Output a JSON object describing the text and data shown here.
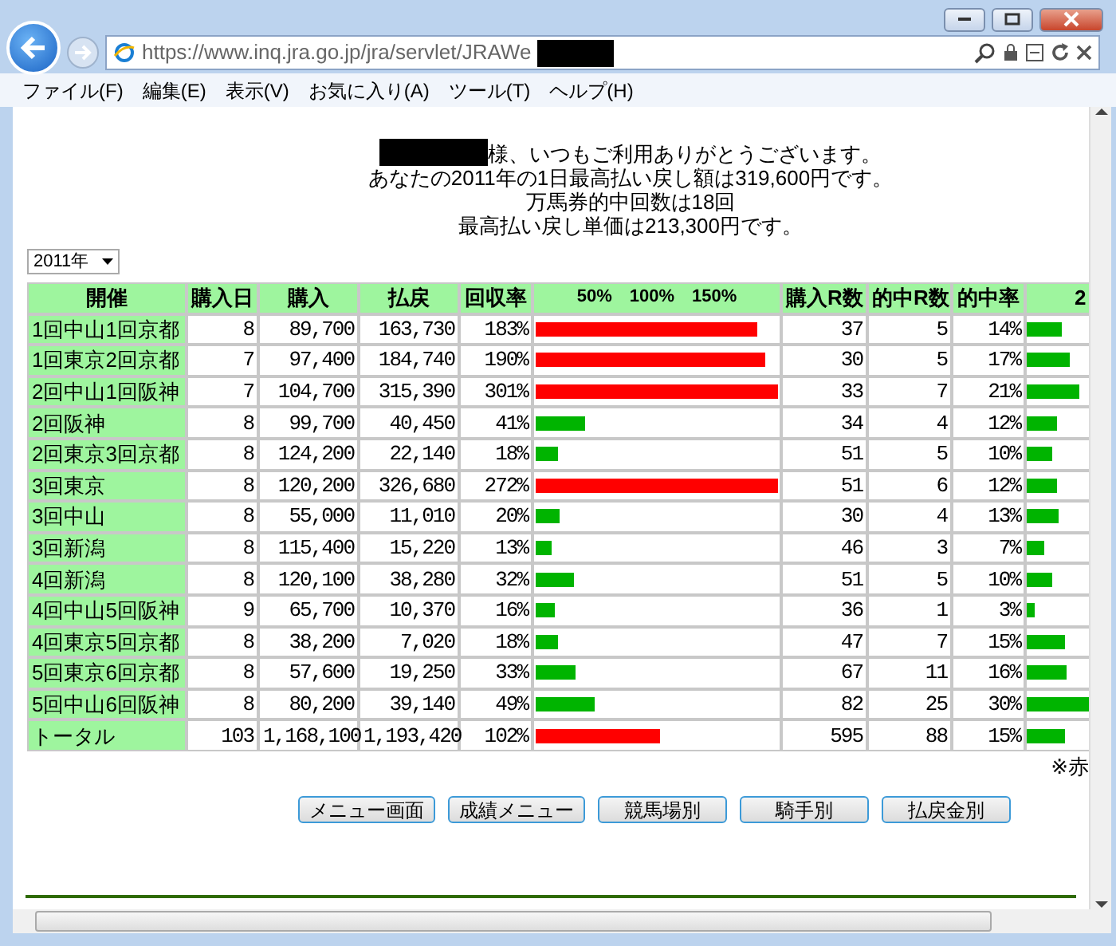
{
  "browser": {
    "url": "https://www.inq.jra.go.jp/jra/servlet/JRAWe",
    "menus": [
      "ファイル(F)",
      "編集(E)",
      "表示(V)",
      "お気に入り(A)",
      "ツール(T)",
      "ヘルプ(H)"
    ]
  },
  "greeting": [
    "様、いつもご利用ありがとうございます。",
    "あなたの2011年の1日最高払い戻し額は319,600円です。",
    "万馬券的中回数は18回",
    "最高払い戻し単価は213,300円です。"
  ],
  "year_select": "2011年",
  "table": {
    "columns": [
      "開催",
      "購入日",
      "購入",
      "払戻",
      "回収率",
      "50%　100%　150%",
      "購入R数",
      "的中R数",
      "的中率",
      "2"
    ],
    "rows": [
      {
        "venue": "1回中山1回京都",
        "days": "8",
        "bought": "89,700",
        "payout": "163,730",
        "rate": "183%",
        "rate_bar": {
          "level": 0.915,
          "color": "#ff0000"
        },
        "races": "37",
        "hits": "5",
        "hit_rate": "14%",
        "hit_bar": {
          "level": 0.14
        }
      },
      {
        "venue": "1回東京2回京都",
        "days": "7",
        "bought": "97,400",
        "payout": "184,740",
        "rate": "190%",
        "rate_bar": {
          "level": 0.95,
          "color": "#ff0000"
        },
        "races": "30",
        "hits": "5",
        "hit_rate": "17%",
        "hit_bar": {
          "level": 0.17
        }
      },
      {
        "venue": "2回中山1回阪神",
        "days": "7",
        "bought": "104,700",
        "payout": "315,390",
        "rate": "301%",
        "rate_bar": {
          "level": 1,
          "color": "#ff0000"
        },
        "races": "33",
        "hits": "7",
        "hit_rate": "21%",
        "hit_bar": {
          "level": 0.21
        }
      },
      {
        "venue": "2回阪神",
        "days": "8",
        "bought": "99,700",
        "payout": "40,450",
        "rate": "41%",
        "rate_bar": {
          "level": 0.205,
          "color": "#00b400"
        },
        "races": "34",
        "hits": "4",
        "hit_rate": "12%",
        "hit_bar": {
          "level": 0.12
        }
      },
      {
        "venue": "2回東京3回京都",
        "days": "8",
        "bought": "124,200",
        "payout": "22,140",
        "rate": "18%",
        "rate_bar": {
          "level": 0.09,
          "color": "#00b400"
        },
        "races": "51",
        "hits": "5",
        "hit_rate": "10%",
        "hit_bar": {
          "level": 0.1
        }
      },
      {
        "venue": "3回東京",
        "days": "8",
        "bought": "120,200",
        "payout": "326,680",
        "rate": "272%",
        "rate_bar": {
          "level": 1,
          "color": "#ff0000"
        },
        "races": "51",
        "hits": "6",
        "hit_rate": "12%",
        "hit_bar": {
          "level": 0.12
        }
      },
      {
        "venue": "3回中山",
        "days": "8",
        "bought": "55,000",
        "payout": "11,010",
        "rate": "20%",
        "rate_bar": {
          "level": 0.1,
          "color": "#00b400"
        },
        "races": "30",
        "hits": "4",
        "hit_rate": "13%",
        "hit_bar": {
          "level": 0.13
        }
      },
      {
        "venue": "3回新潟",
        "days": "8",
        "bought": "115,400",
        "payout": "15,220",
        "rate": "13%",
        "rate_bar": {
          "level": 0.065,
          "color": "#00b400"
        },
        "races": "46",
        "hits": "3",
        "hit_rate": "7%",
        "hit_bar": {
          "level": 0.07
        }
      },
      {
        "venue": "4回新潟",
        "days": "8",
        "bought": "120,100",
        "payout": "38,280",
        "rate": "32%",
        "rate_bar": {
          "level": 0.16,
          "color": "#00b400"
        },
        "races": "51",
        "hits": "5",
        "hit_rate": "10%",
        "hit_bar": {
          "level": 0.1
        }
      },
      {
        "venue": "4回中山5回阪神",
        "days": "9",
        "bought": "65,700",
        "payout": "10,370",
        "rate": "16%",
        "rate_bar": {
          "level": 0.08,
          "color": "#00b400"
        },
        "races": "36",
        "hits": "1",
        "hit_rate": "3%",
        "hit_bar": {
          "level": 0.03
        }
      },
      {
        "venue": "4回東京5回京都",
        "days": "8",
        "bought": "38,200",
        "payout": "7,020",
        "rate": "18%",
        "rate_bar": {
          "level": 0.09,
          "color": "#00b400"
        },
        "races": "47",
        "hits": "7",
        "hit_rate": "15%",
        "hit_bar": {
          "level": 0.15
        }
      },
      {
        "venue": "5回東京6回京都",
        "days": "8",
        "bought": "57,600",
        "payout": "19,250",
        "rate": "33%",
        "rate_bar": {
          "level": 0.165,
          "color": "#00b400"
        },
        "races": "67",
        "hits": "11",
        "hit_rate": "16%",
        "hit_bar": {
          "level": 0.16
        }
      },
      {
        "venue": "5回中山6回阪神",
        "days": "8",
        "bought": "80,200",
        "payout": "39,140",
        "rate": "49%",
        "rate_bar": {
          "level": 0.245,
          "color": "#00b400"
        },
        "races": "82",
        "hits": "25",
        "hit_rate": "30%",
        "hit_bar": {
          "level": 0.3
        }
      },
      {
        "venue": "トータル",
        "days": "103",
        "bought": "1,168,100",
        "payout": "1,193,420",
        "rate": "102%",
        "rate_bar": {
          "level": 0.51,
          "color": "#ff0000"
        },
        "races": "595",
        "hits": "88",
        "hit_rate": "15%",
        "hit_bar": {
          "level": 0.15
        }
      }
    ]
  },
  "note": "※赤",
  "buttons": [
    "メニュー画面",
    "成績メニュー",
    "競馬場別",
    "騎手別",
    "払戻金別"
  ]
}
